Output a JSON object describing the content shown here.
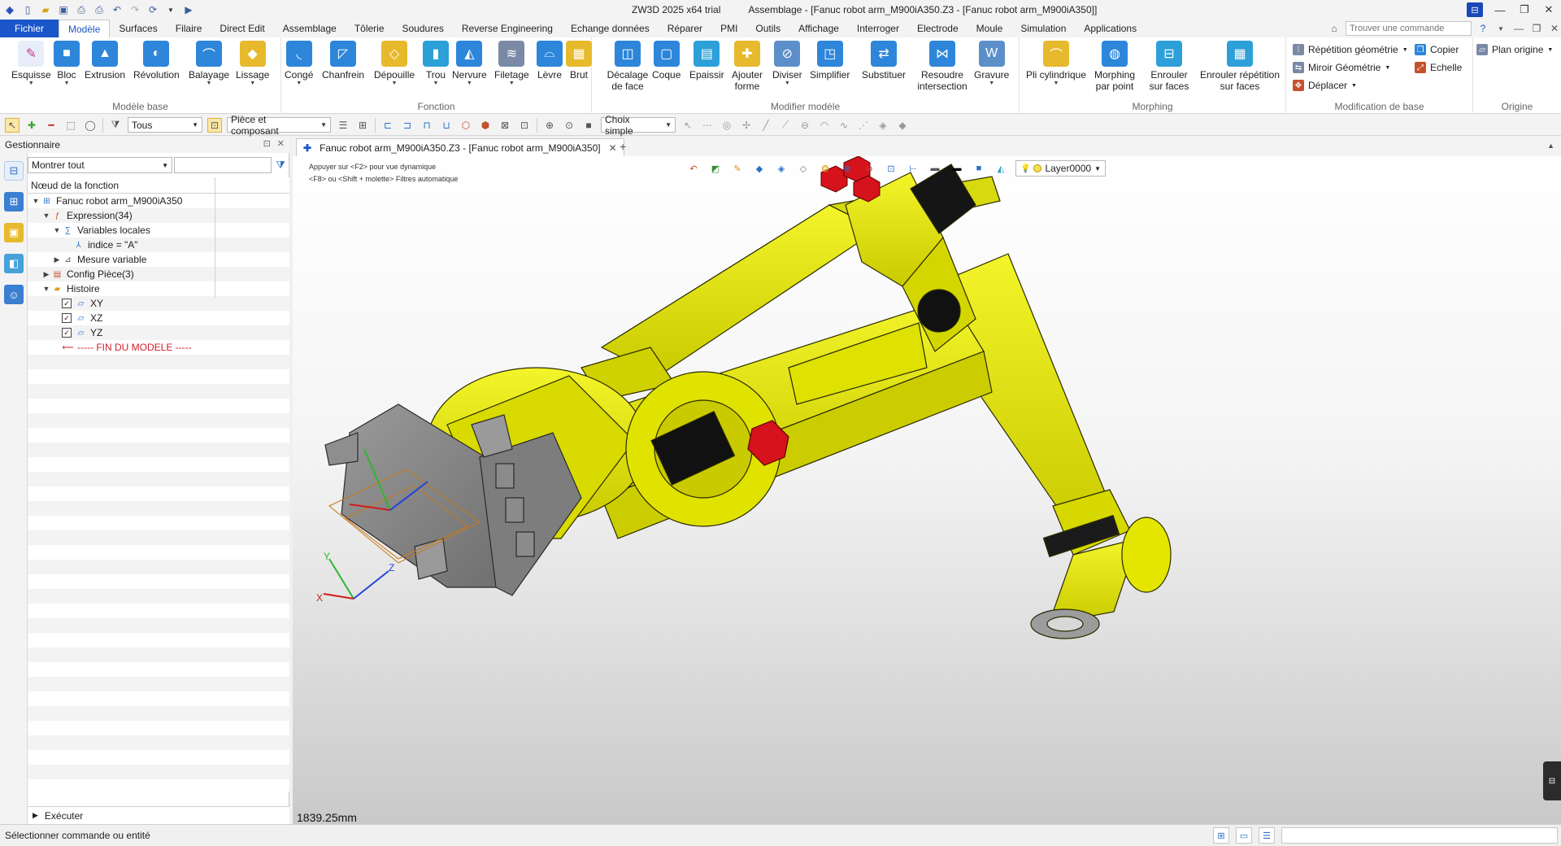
{
  "window": {
    "title": "ZW3D 2025 x64 trial",
    "subtitle": "Assemblage - [Fanuc robot arm_M900iA350.Z3 - [Fanuc robot arm_M900iA350]]"
  },
  "quick_access": [
    "app-logo-icon",
    "new-file-icon",
    "open-folder-icon",
    "save-icon",
    "print-icon",
    "print-preview-icon",
    "undo-icon",
    "redo-icon",
    "refresh-icon",
    "run-icon"
  ],
  "ribbon_tabs": [
    "Fichier",
    "Modèle",
    "Surfaces",
    "Filaire",
    "Direct Edit",
    "Assemblage",
    "Tôlerie",
    "Soudures",
    "Reverse Engineering",
    "Echange données",
    "Réparer",
    "PMI",
    "Outils",
    "Affichage",
    "Interroger",
    "Electrode",
    "Moule",
    "Simulation",
    "Applications"
  ],
  "active_tab": "Modèle",
  "command_search": {
    "placeholder": "Trouver une commande"
  },
  "ribbon_groups": {
    "base": {
      "label": "Modèle base",
      "buttons": [
        "Esquisse",
        "Bloc",
        "Extrusion",
        "Révolution",
        "Balayage",
        "Lissage"
      ]
    },
    "function": {
      "label": "Fonction",
      "buttons": [
        "Congé",
        "Chanfrein",
        "Dépouille",
        "Trou",
        "Nervure",
        "Filetage",
        "Lèvre",
        "Brut"
      ]
    },
    "modify": {
      "label": "Modifier modèle",
      "buttons": [
        "Décalage de face",
        "Coque",
        "Epaissir",
        "Ajouter forme",
        "Diviser",
        "Simplifier",
        "Substituer",
        "Resoudre intersection",
        "Gravure"
      ]
    },
    "morphing": {
      "label": "Morphing",
      "buttons": [
        "Pli cylindrique",
        "Morphing par point",
        "Enrouler sur faces",
        "Enrouler répétition sur faces"
      ]
    },
    "basic_mod": {
      "label": "Modification de base",
      "items": [
        "Répétition géométrie",
        "Miroir Géométrie",
        "Déplacer",
        "Copier",
        "Echelle"
      ]
    },
    "origin": {
      "label": "Origine",
      "items": [
        "Plan origine"
      ]
    }
  },
  "toolbar": {
    "filter_value": "Tous",
    "scope_value": "Pièce et composant",
    "pick_mode": "Choix simple"
  },
  "manager": {
    "title": "Gestionnaire",
    "show_all": "Montrer tout",
    "column_header": "Nœud de la fonction",
    "tree": [
      {
        "label": "Fanuc robot arm_M900iA350",
        "level": 0,
        "expand": "▼",
        "icon": "assembly-icon"
      },
      {
        "label": "Expression(34)",
        "level": 1,
        "expand": "▼",
        "icon": "expression-icon"
      },
      {
        "label": "Variables locales",
        "level": 2,
        "expand": "▼",
        "icon": "variables-icon"
      },
      {
        "label": "indice = \"A\"",
        "level": 3,
        "expand": "",
        "icon": "variable-icon"
      },
      {
        "label": "Mesure variable",
        "level": 2,
        "expand": "▶",
        "icon": "measure-icon"
      },
      {
        "label": "Config Pièce(3)",
        "level": 1,
        "expand": "▶",
        "icon": "config-icon"
      },
      {
        "label": "Histoire",
        "level": 1,
        "expand": "▼",
        "icon": "history-folder-icon"
      },
      {
        "label": "XY",
        "level": 2,
        "expand": "",
        "icon": "plane-icon",
        "checked": true
      },
      {
        "label": "XZ",
        "level": 2,
        "expand": "",
        "icon": "plane-icon",
        "checked": true
      },
      {
        "label": "YZ",
        "level": 2,
        "expand": "",
        "icon": "plane-icon",
        "checked": true
      },
      {
        "label": "----- FIN DU MODELE -----",
        "level": 2,
        "expand": "",
        "icon": "end-arrow-icon",
        "end": true
      }
    ],
    "execute": "Exécuter"
  },
  "document_tab": "Fanuc robot arm_M900iA350.Z3 - [Fanuc robot arm_M900iA350]",
  "viewport": {
    "hint_line1": "Appuyer sur <F2> pour vue dynamique",
    "hint_line2": "<F8> ou <Shift + molette> Filtres automatique",
    "layer": "Layer0000",
    "scale_readout": "1839.25mm",
    "axes": {
      "x": "X",
      "y": "Y",
      "z": "Z"
    }
  },
  "statusbar": {
    "message": "Sélectionner commande ou entité"
  },
  "colors": {
    "accent": "#1a56c9",
    "robot_yellow": "#e3e600",
    "cap_red": "#d6121d",
    "motor_grey": "#8a8a8a"
  }
}
